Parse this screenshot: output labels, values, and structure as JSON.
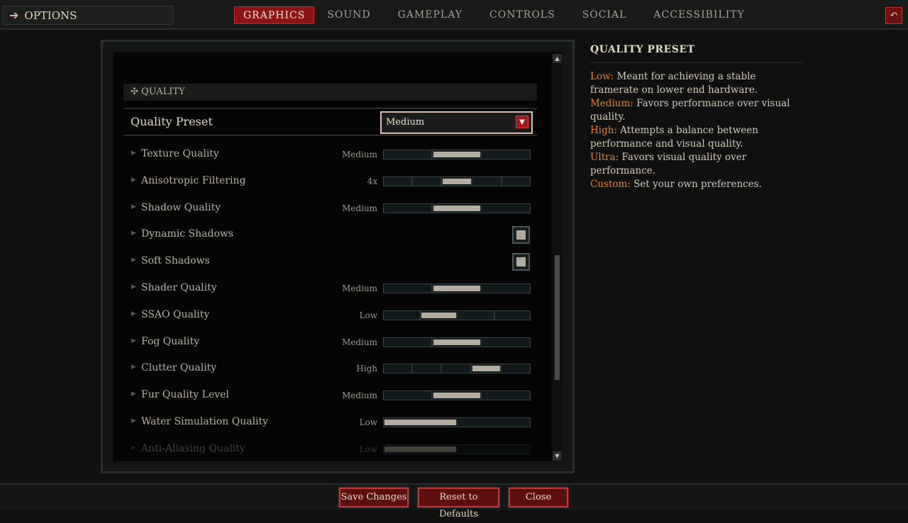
{
  "header": {
    "title": "OPTIONS",
    "tabs": [
      {
        "label": "GRAPHICS",
        "active": true
      },
      {
        "label": "SOUND"
      },
      {
        "label": "GAMEPLAY"
      },
      {
        "label": "CONTROLS"
      },
      {
        "label": "SOCIAL"
      },
      {
        "label": "ACCESSIBILITY"
      }
    ]
  },
  "section": {
    "title": "QUALITY"
  },
  "preset": {
    "label": "Quality Preset",
    "value": "Medium"
  },
  "settings": [
    {
      "name": "Texture Quality",
      "type": "slider",
      "value": "Medium",
      "segments": 3,
      "selected": 1
    },
    {
      "name": "Anisotropic Filtering",
      "type": "slider",
      "value": "4x",
      "segments": 5,
      "selected": 2
    },
    {
      "name": "Shadow Quality",
      "type": "slider",
      "value": "Medium",
      "segments": 3,
      "selected": 1
    },
    {
      "name": "Dynamic Shadows",
      "type": "checkbox",
      "checked": true
    },
    {
      "name": "Soft Shadows",
      "type": "checkbox",
      "checked": true
    },
    {
      "name": "Shader Quality",
      "type": "slider",
      "value": "Medium",
      "segments": 3,
      "selected": 1
    },
    {
      "name": "SSAO Quality",
      "type": "slider",
      "value": "Low",
      "segments": 4,
      "selected": 1
    },
    {
      "name": "Fog Quality",
      "type": "slider",
      "value": "Medium",
      "segments": 3,
      "selected": 1
    },
    {
      "name": "Clutter Quality",
      "type": "slider",
      "value": "High",
      "segments": 5,
      "selected": 3
    },
    {
      "name": "Fur Quality Level",
      "type": "slider",
      "value": "Medium",
      "segments": 3,
      "selected": 1
    },
    {
      "name": "Water Simulation Quality",
      "type": "slider",
      "value": "Low",
      "segments": 2,
      "selected": 0
    },
    {
      "name": "Anti-Aliasing Quality",
      "type": "slider",
      "value": "Low",
      "segments": 2,
      "selected": 0,
      "faded": true
    }
  ],
  "help": {
    "title": "QUALITY PRESET",
    "entries": [
      {
        "key": "Low:",
        "text": " Meant for achieving a stable framerate on lower end hardware."
      },
      {
        "key": "Medium:",
        "text": " Favors performance over visual quality."
      },
      {
        "key": "High:",
        "text": " Attempts a balance between performance and visual quality."
      },
      {
        "key": "Ultra:",
        "text": " Favors visual quality over performance."
      },
      {
        "key": "Custom:",
        "text": " Set your own preferences."
      }
    ]
  },
  "buttons": {
    "save": "Save Changes",
    "reset": "Reset to Defaults",
    "close": "Close"
  },
  "colors": {
    "accent": "#8a1414",
    "highlight": "#e8822c"
  }
}
